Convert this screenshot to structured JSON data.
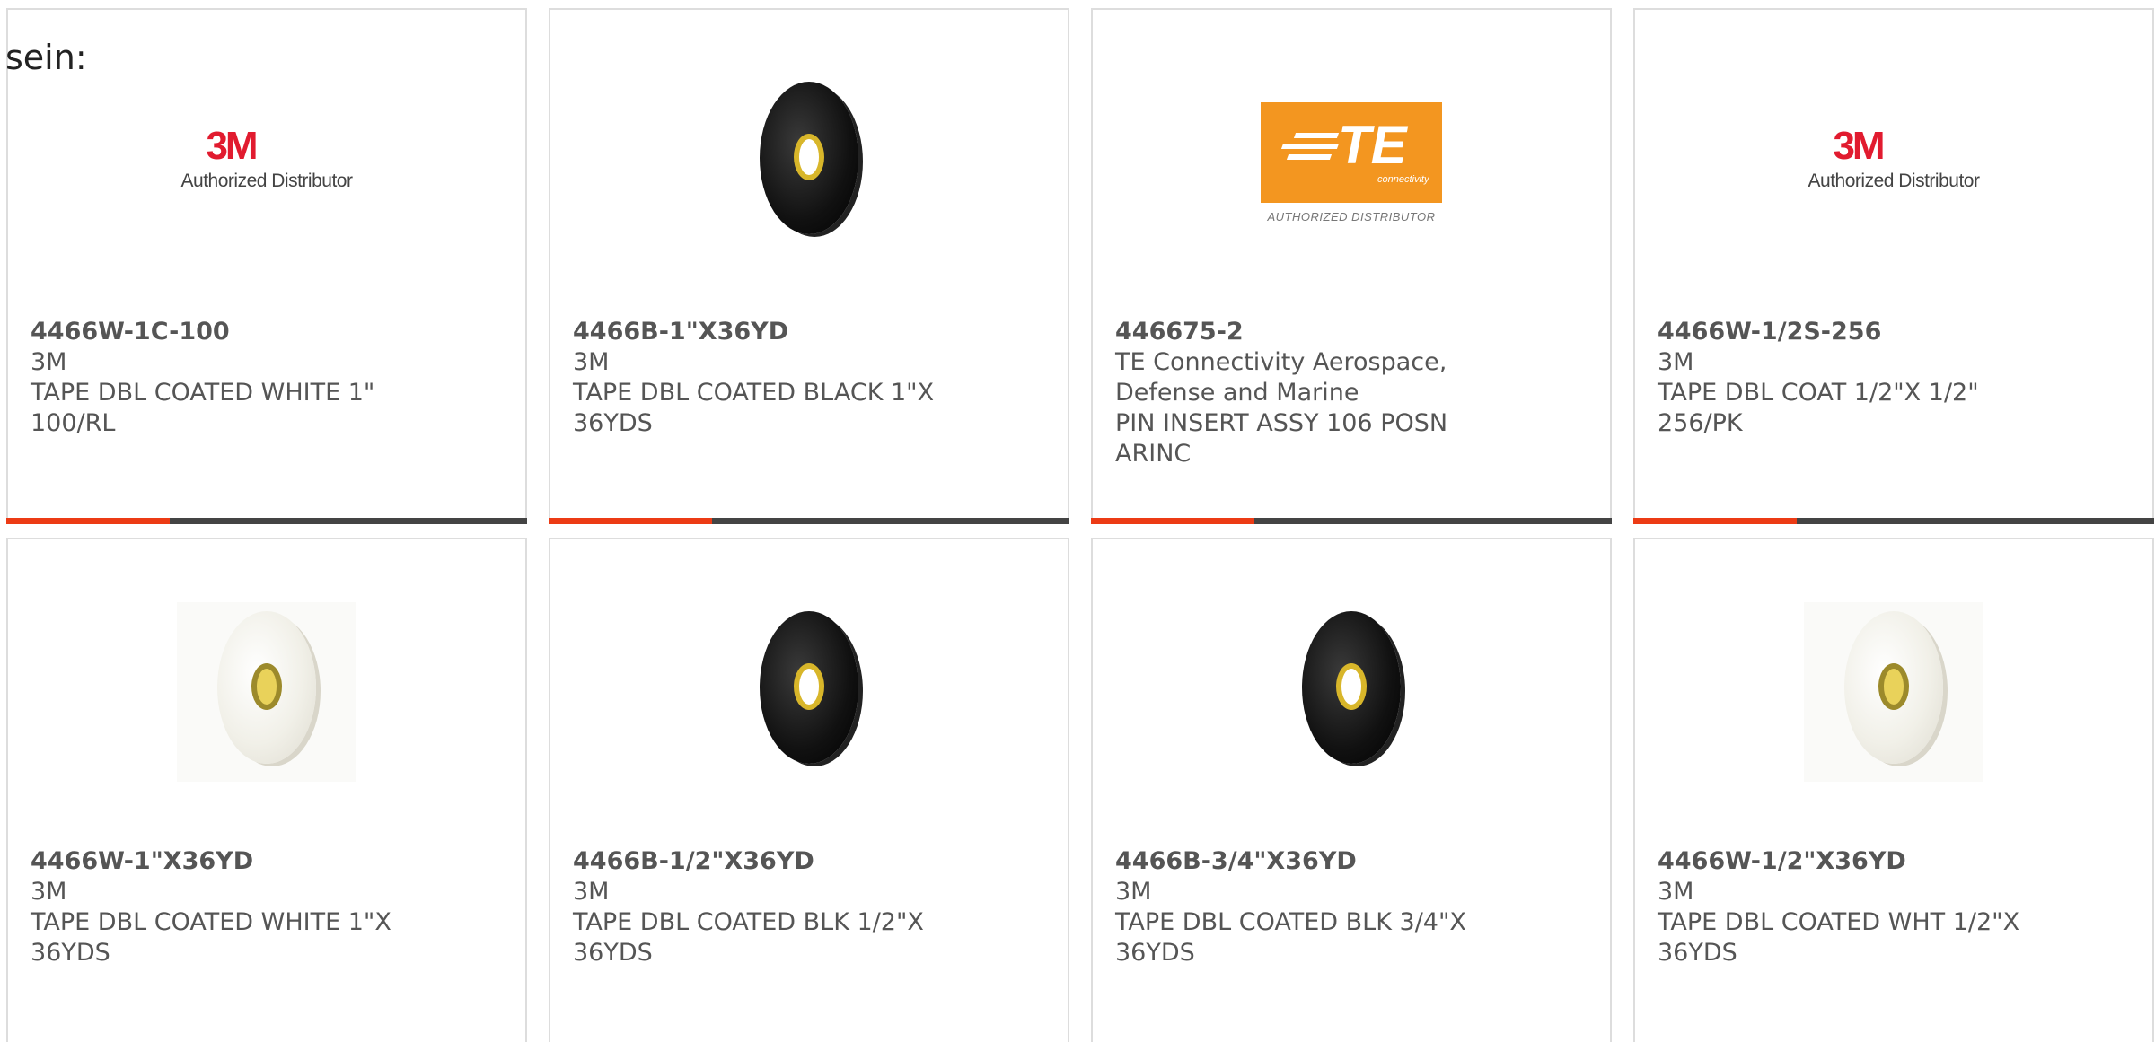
{
  "intro": {
    "text": "sein:"
  },
  "colors": {
    "accent": "#ec3b15",
    "bar": "#444444",
    "text": "#555555",
    "brand_3m": "#e11b2f",
    "brand_te": "#f39620"
  },
  "products": [
    {
      "part_number": "4466W-1C-100",
      "manufacturer": "3M",
      "description": "TAPE DBL COATED WHITE 1\" 100/RL",
      "image": "3m-authorized-distributor-logo",
      "logo_text": "3M",
      "logo_subtext": "Authorized Distributor"
    },
    {
      "part_number": "4466B-1\"X36YD",
      "manufacturer": "3M",
      "description": "TAPE DBL COATED BLACK 1\"X 36YDS",
      "image": "black-tape-roll-icon"
    },
    {
      "part_number": "446675-2",
      "manufacturer": "TE Connectivity Aerospace, Defense and Marine",
      "description": "PIN INSERT ASSY 106 POSN ARINC",
      "image": "te-authorized-distributor-logo",
      "logo_text": "TE",
      "logo_conn": "connectivity",
      "logo_subtext": "AUTHORIZED DISTRIBUTOR"
    },
    {
      "part_number": "4466W-1/2S-256",
      "manufacturer": "3M",
      "description": "TAPE DBL COAT 1/2\"X 1/2\" 256/PK",
      "image": "3m-authorized-distributor-logo",
      "logo_text": "3M",
      "logo_subtext": "Authorized Distributor"
    },
    {
      "part_number": "4466W-1\"X36YD",
      "manufacturer": "3M",
      "description": "TAPE DBL COATED WHITE 1\"X 36YDS",
      "image": "white-tape-roll-icon"
    },
    {
      "part_number": "4466B-1/2\"X36YD",
      "manufacturer": "3M",
      "description": "TAPE DBL COATED BLK 1/2\"X 36YDS",
      "image": "black-tape-roll-icon"
    },
    {
      "part_number": "4466B-3/4\"X36YD",
      "manufacturer": "3M",
      "description": "TAPE DBL COATED BLK 3/4\"X 36YDS",
      "image": "black-tape-roll-icon"
    },
    {
      "part_number": "4466W-1/2\"X36YD",
      "manufacturer": "3M",
      "description": "TAPE DBL COATED WHT 1/2\"X 36YDS",
      "image": "white-tape-roll-icon"
    }
  ]
}
